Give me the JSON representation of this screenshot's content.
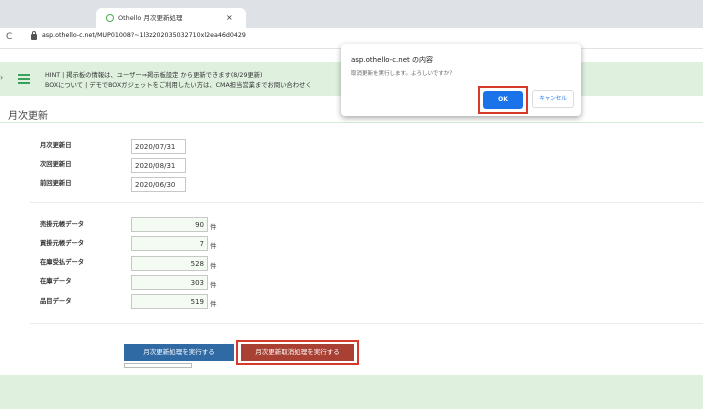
{
  "browser": {
    "tab_title": "Othello 月次更新処理",
    "tab_close": "×",
    "url": "asp.othello-c.net/MUP01008?~1l3z202035032710xl2ea46d0429"
  },
  "hint": {
    "line1": "HINT | 掲示板の情報は、ユーザー⇒掲示板設定 から更新できます(8/29更新)",
    "line2": "BOXについて | デモでBOXガジェットをご利用したい方は、CMA担当営業までお問い合わせく"
  },
  "page": {
    "title": "月次更新"
  },
  "dates": [
    {
      "label": "月次更新日",
      "value": "2020/07/31"
    },
    {
      "label": "次回更新日",
      "value": "2020/08/31"
    },
    {
      "label": "前回更新日",
      "value": "2020/06/30"
    }
  ],
  "counts": [
    {
      "label": "売掛元帳データ",
      "value": "90",
      "unit": "件"
    },
    {
      "label": "買掛元帳データ",
      "value": "7",
      "unit": "件"
    },
    {
      "label": "在庫受払データ",
      "value": "528",
      "unit": "件"
    },
    {
      "label": "在庫データ",
      "value": "303",
      "unit": "件"
    },
    {
      "label": "品目データ",
      "value": "519",
      "unit": "件"
    }
  ],
  "buttons": {
    "execute": "月次更新処理を実行する",
    "cancel_execute": "月次更新取消処理を実行する"
  },
  "dialog": {
    "title": "asp.othello-c.net の内容",
    "message": "取消更新を実行します。よろしいですか？",
    "ok": "OK",
    "cancel": "キャンセル"
  },
  "colors": {
    "accent_green": "#dff0df",
    "primary_blue": "#2f6aa5",
    "danger_red": "#a84134",
    "highlight_red": "#d53a2a",
    "dialog_blue": "#1a73e8"
  }
}
